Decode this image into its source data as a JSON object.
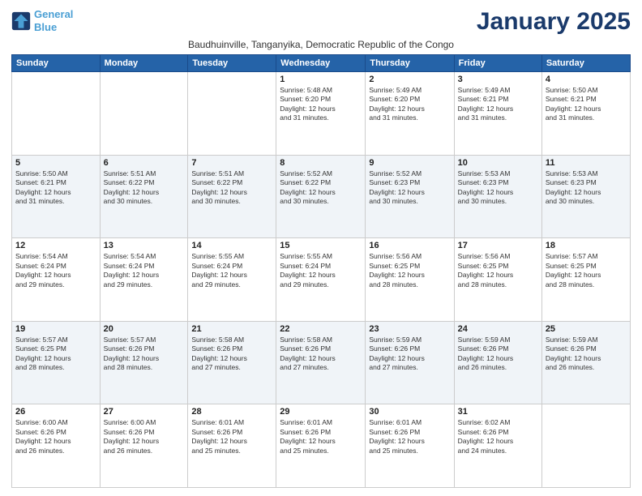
{
  "logo": {
    "line1": "General",
    "line2": "Blue"
  },
  "title": "January 2025",
  "subtitle": "Baudhuinville, Tanganyika, Democratic Republic of the Congo",
  "days_of_week": [
    "Sunday",
    "Monday",
    "Tuesday",
    "Wednesday",
    "Thursday",
    "Friday",
    "Saturday"
  ],
  "weeks": [
    [
      {
        "day": "",
        "info": ""
      },
      {
        "day": "",
        "info": ""
      },
      {
        "day": "",
        "info": ""
      },
      {
        "day": "1",
        "info": "Sunrise: 5:48 AM\nSunset: 6:20 PM\nDaylight: 12 hours\nand 31 minutes."
      },
      {
        "day": "2",
        "info": "Sunrise: 5:49 AM\nSunset: 6:20 PM\nDaylight: 12 hours\nand 31 minutes."
      },
      {
        "day": "3",
        "info": "Sunrise: 5:49 AM\nSunset: 6:21 PM\nDaylight: 12 hours\nand 31 minutes."
      },
      {
        "day": "4",
        "info": "Sunrise: 5:50 AM\nSunset: 6:21 PM\nDaylight: 12 hours\nand 31 minutes."
      }
    ],
    [
      {
        "day": "5",
        "info": "Sunrise: 5:50 AM\nSunset: 6:21 PM\nDaylight: 12 hours\nand 31 minutes."
      },
      {
        "day": "6",
        "info": "Sunrise: 5:51 AM\nSunset: 6:22 PM\nDaylight: 12 hours\nand 30 minutes."
      },
      {
        "day": "7",
        "info": "Sunrise: 5:51 AM\nSunset: 6:22 PM\nDaylight: 12 hours\nand 30 minutes."
      },
      {
        "day": "8",
        "info": "Sunrise: 5:52 AM\nSunset: 6:22 PM\nDaylight: 12 hours\nand 30 minutes."
      },
      {
        "day": "9",
        "info": "Sunrise: 5:52 AM\nSunset: 6:23 PM\nDaylight: 12 hours\nand 30 minutes."
      },
      {
        "day": "10",
        "info": "Sunrise: 5:53 AM\nSunset: 6:23 PM\nDaylight: 12 hours\nand 30 minutes."
      },
      {
        "day": "11",
        "info": "Sunrise: 5:53 AM\nSunset: 6:23 PM\nDaylight: 12 hours\nand 30 minutes."
      }
    ],
    [
      {
        "day": "12",
        "info": "Sunrise: 5:54 AM\nSunset: 6:24 PM\nDaylight: 12 hours\nand 29 minutes."
      },
      {
        "day": "13",
        "info": "Sunrise: 5:54 AM\nSunset: 6:24 PM\nDaylight: 12 hours\nand 29 minutes."
      },
      {
        "day": "14",
        "info": "Sunrise: 5:55 AM\nSunset: 6:24 PM\nDaylight: 12 hours\nand 29 minutes."
      },
      {
        "day": "15",
        "info": "Sunrise: 5:55 AM\nSunset: 6:24 PM\nDaylight: 12 hours\nand 29 minutes."
      },
      {
        "day": "16",
        "info": "Sunrise: 5:56 AM\nSunset: 6:25 PM\nDaylight: 12 hours\nand 28 minutes."
      },
      {
        "day": "17",
        "info": "Sunrise: 5:56 AM\nSunset: 6:25 PM\nDaylight: 12 hours\nand 28 minutes."
      },
      {
        "day": "18",
        "info": "Sunrise: 5:57 AM\nSunset: 6:25 PM\nDaylight: 12 hours\nand 28 minutes."
      }
    ],
    [
      {
        "day": "19",
        "info": "Sunrise: 5:57 AM\nSunset: 6:25 PM\nDaylight: 12 hours\nand 28 minutes."
      },
      {
        "day": "20",
        "info": "Sunrise: 5:57 AM\nSunset: 6:26 PM\nDaylight: 12 hours\nand 28 minutes."
      },
      {
        "day": "21",
        "info": "Sunrise: 5:58 AM\nSunset: 6:26 PM\nDaylight: 12 hours\nand 27 minutes."
      },
      {
        "day": "22",
        "info": "Sunrise: 5:58 AM\nSunset: 6:26 PM\nDaylight: 12 hours\nand 27 minutes."
      },
      {
        "day": "23",
        "info": "Sunrise: 5:59 AM\nSunset: 6:26 PM\nDaylight: 12 hours\nand 27 minutes."
      },
      {
        "day": "24",
        "info": "Sunrise: 5:59 AM\nSunset: 6:26 PM\nDaylight: 12 hours\nand 26 minutes."
      },
      {
        "day": "25",
        "info": "Sunrise: 5:59 AM\nSunset: 6:26 PM\nDaylight: 12 hours\nand 26 minutes."
      }
    ],
    [
      {
        "day": "26",
        "info": "Sunrise: 6:00 AM\nSunset: 6:26 PM\nDaylight: 12 hours\nand 26 minutes."
      },
      {
        "day": "27",
        "info": "Sunrise: 6:00 AM\nSunset: 6:26 PM\nDaylight: 12 hours\nand 26 minutes."
      },
      {
        "day": "28",
        "info": "Sunrise: 6:01 AM\nSunset: 6:26 PM\nDaylight: 12 hours\nand 25 minutes."
      },
      {
        "day": "29",
        "info": "Sunrise: 6:01 AM\nSunset: 6:26 PM\nDaylight: 12 hours\nand 25 minutes."
      },
      {
        "day": "30",
        "info": "Sunrise: 6:01 AM\nSunset: 6:26 PM\nDaylight: 12 hours\nand 25 minutes."
      },
      {
        "day": "31",
        "info": "Sunrise: 6:02 AM\nSunset: 6:26 PM\nDaylight: 12 hours\nand 24 minutes."
      },
      {
        "day": "",
        "info": ""
      }
    ]
  ]
}
